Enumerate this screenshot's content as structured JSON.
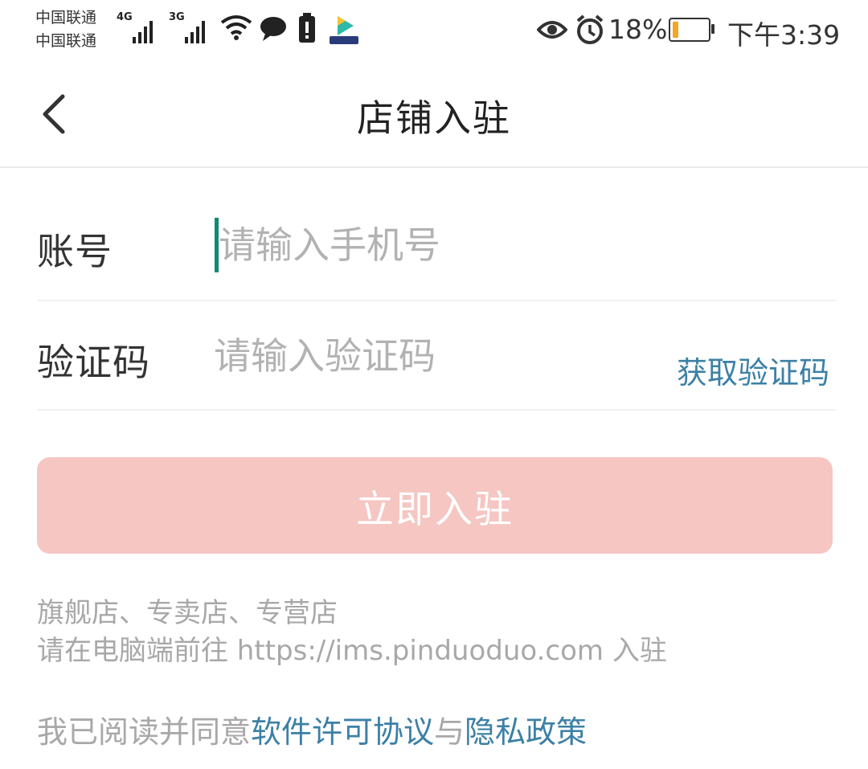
{
  "status_bar": {
    "carrier_1": "中国联通",
    "carrier_2": "中国联通",
    "signal_1_tag": "4G",
    "signal_2_tag": "3G",
    "battery_percent": "18%",
    "battery_level": 0.18,
    "time": "下午3:39",
    "icons": [
      "signal-icon",
      "wifi-icon",
      "message-icon",
      "sim-alert-icon",
      "video-app-icon",
      "eye-icon",
      "alarm-icon",
      "battery-icon"
    ]
  },
  "nav": {
    "back_icon": "back-icon",
    "title": "店铺入驻"
  },
  "form": {
    "account_label": "账号",
    "account_placeholder": "请输入手机号",
    "account_value": "",
    "code_label": "验证码",
    "code_placeholder": "请输入验证码",
    "code_value": "",
    "get_code_label": "获取验证码"
  },
  "submit_label": "立即入驻",
  "notice": {
    "line1": "旗舰店、专卖店、专营店",
    "line2": "请在电脑端前往 https://ims.pinduoduo.com 入驻"
  },
  "agreement": {
    "prefix": "我已阅读并同意",
    "license_link": "软件许可协议",
    "joiner": "与",
    "privacy_link": "隐私政策"
  },
  "colors": {
    "accent_link": "#3c80a6",
    "submit_disabled_bg": "#f5c6c2",
    "caret": "#0f8a74",
    "battery_fill": "#f5a623"
  }
}
